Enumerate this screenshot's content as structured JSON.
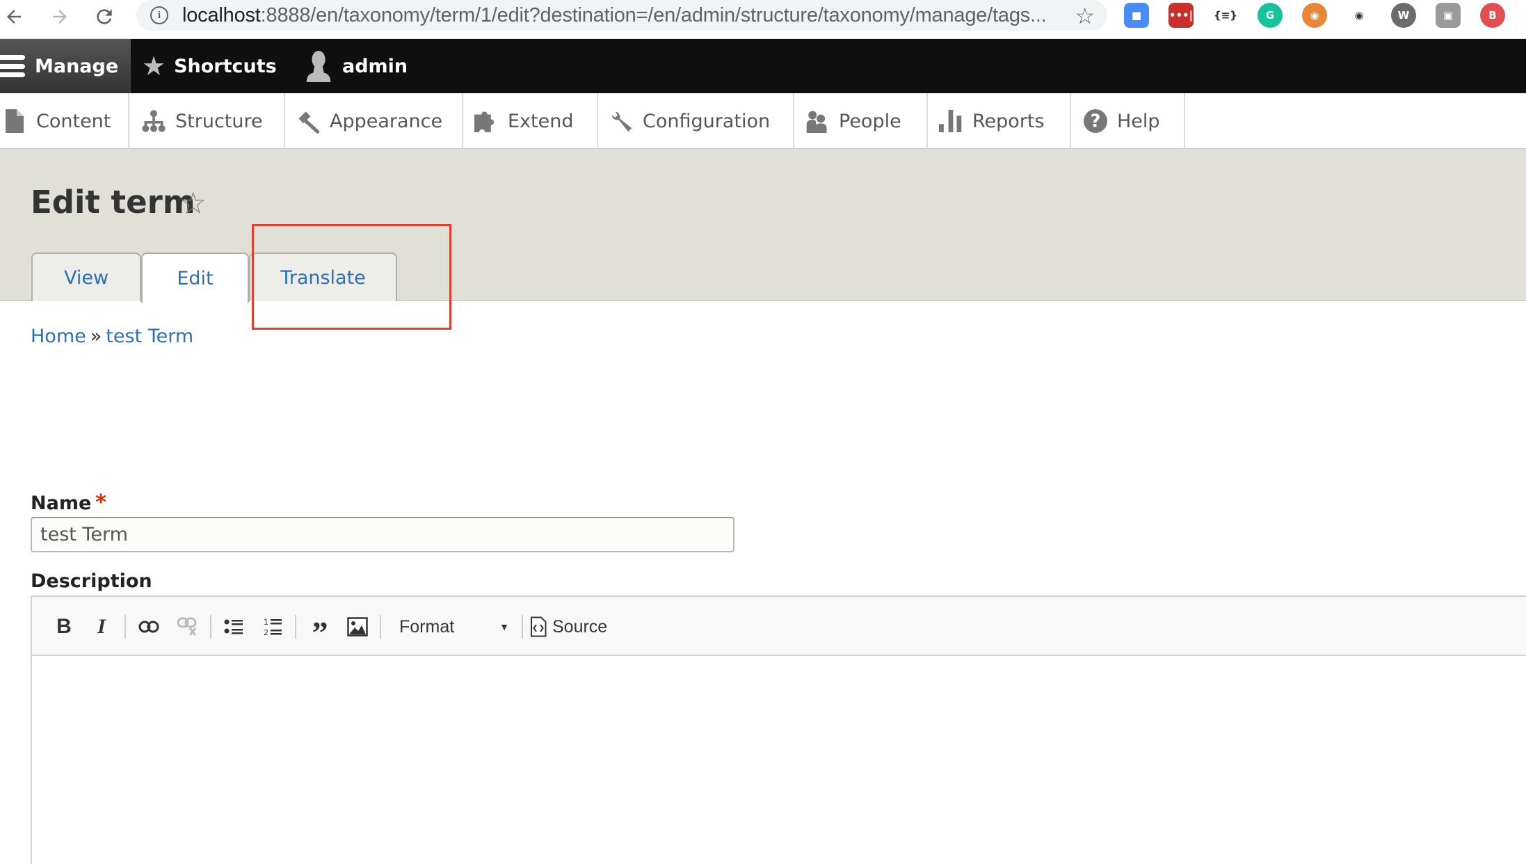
{
  "browser": {
    "url_host": "localhost",
    "url_rest": ":8888/en/taxonomy/term/1/edit?destination=/en/admin/structure/taxonomy/manage/tags...",
    "extensions": [
      {
        "name": "zoom-extension",
        "color": "#4a8cf7",
        "glyph": "■"
      },
      {
        "name": "lastpass-extension",
        "color": "#c9302c",
        "glyph": "•••|"
      },
      {
        "name": "json-formatter-extension",
        "color": "#ffffff",
        "glyph": "{≡}"
      },
      {
        "name": "grammarly-extension",
        "color": "#15c39a",
        "glyph": "G"
      },
      {
        "name": "colorzilla-extension",
        "color": "#e8863a",
        "glyph": "◉"
      },
      {
        "name": "eye-extension",
        "color": "#ffffff",
        "glyph": "◉"
      },
      {
        "name": "wappalyzer-extension",
        "color": "#6b6b6b",
        "glyph": "W"
      },
      {
        "name": "screenshot-extension",
        "color": "#9a9a9a",
        "glyph": "▣"
      },
      {
        "name": "bitly-extension",
        "color": "#e05052",
        "glyph": "B"
      }
    ]
  },
  "toolbar": {
    "manage": "Manage",
    "shortcuts": "Shortcuts",
    "user": "admin"
  },
  "tray": {
    "items": [
      {
        "label": "Content",
        "icon": "content-icon"
      },
      {
        "label": "Structure",
        "icon": "structure-icon"
      },
      {
        "label": "Appearance",
        "icon": "appearance-icon"
      },
      {
        "label": "Extend",
        "icon": "extend-icon"
      },
      {
        "label": "Configuration",
        "icon": "configuration-icon"
      },
      {
        "label": "People",
        "icon": "people-icon"
      },
      {
        "label": "Reports",
        "icon": "reports-icon"
      },
      {
        "label": "Help",
        "icon": "help-icon"
      }
    ]
  },
  "page": {
    "title": "Edit term",
    "tabs": [
      {
        "label": "View",
        "active": false
      },
      {
        "label": "Edit",
        "active": true
      },
      {
        "label": "Translate",
        "active": false
      }
    ],
    "breadcrumb": [
      {
        "label": "Home"
      },
      {
        "label": "test Term"
      }
    ],
    "breadcrumb_separator": "»"
  },
  "form": {
    "name_label": "Name",
    "name_required_marker": "*",
    "name_value": "test Term",
    "description_label": "Description",
    "editor": {
      "format_label": "Format",
      "source_label": "Source"
    }
  },
  "colors": {
    "link": "#2c70b3",
    "highlight": "#e0402a",
    "required": "#e62600"
  }
}
